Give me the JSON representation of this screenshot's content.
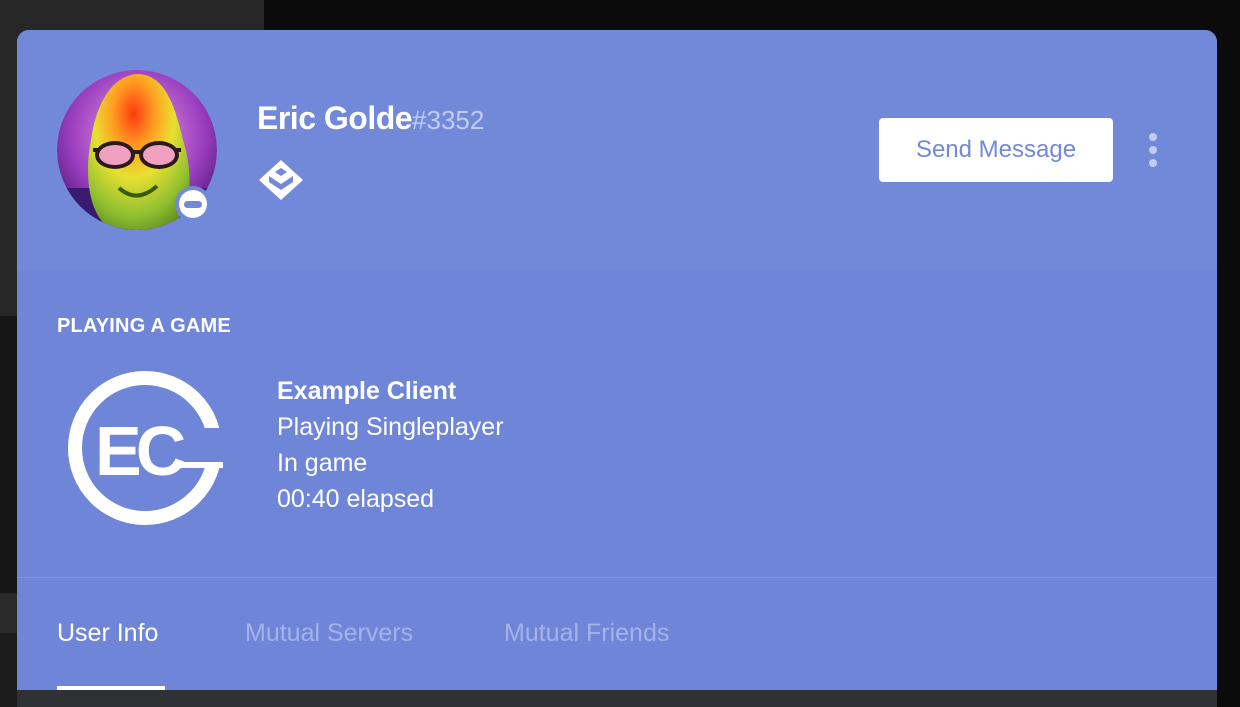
{
  "profile": {
    "username": "Eric Golde",
    "discriminator": "#3352",
    "status": "dnd",
    "badge_icon": "hypesquad-badge-icon",
    "avatar_icon": "pear-with-sunglasses-avatar"
  },
  "actions": {
    "send_message_label": "Send Message",
    "more_icon": "more-vertical-icon"
  },
  "activity": {
    "header": "PLAYING A GAME",
    "game_icon": "ec-logo-icon",
    "game_name": "Example Client",
    "details": "Playing Singleplayer",
    "state": "In game",
    "elapsed": "00:40 elapsed"
  },
  "tabs": [
    {
      "label": "User Info",
      "active": true
    },
    {
      "label": "Mutual Servers",
      "active": false
    },
    {
      "label": "Mutual Friends",
      "active": false
    }
  ],
  "colors": {
    "blurple": "#7289da",
    "activity_bg": "#6f86d8",
    "white": "#ffffff"
  }
}
